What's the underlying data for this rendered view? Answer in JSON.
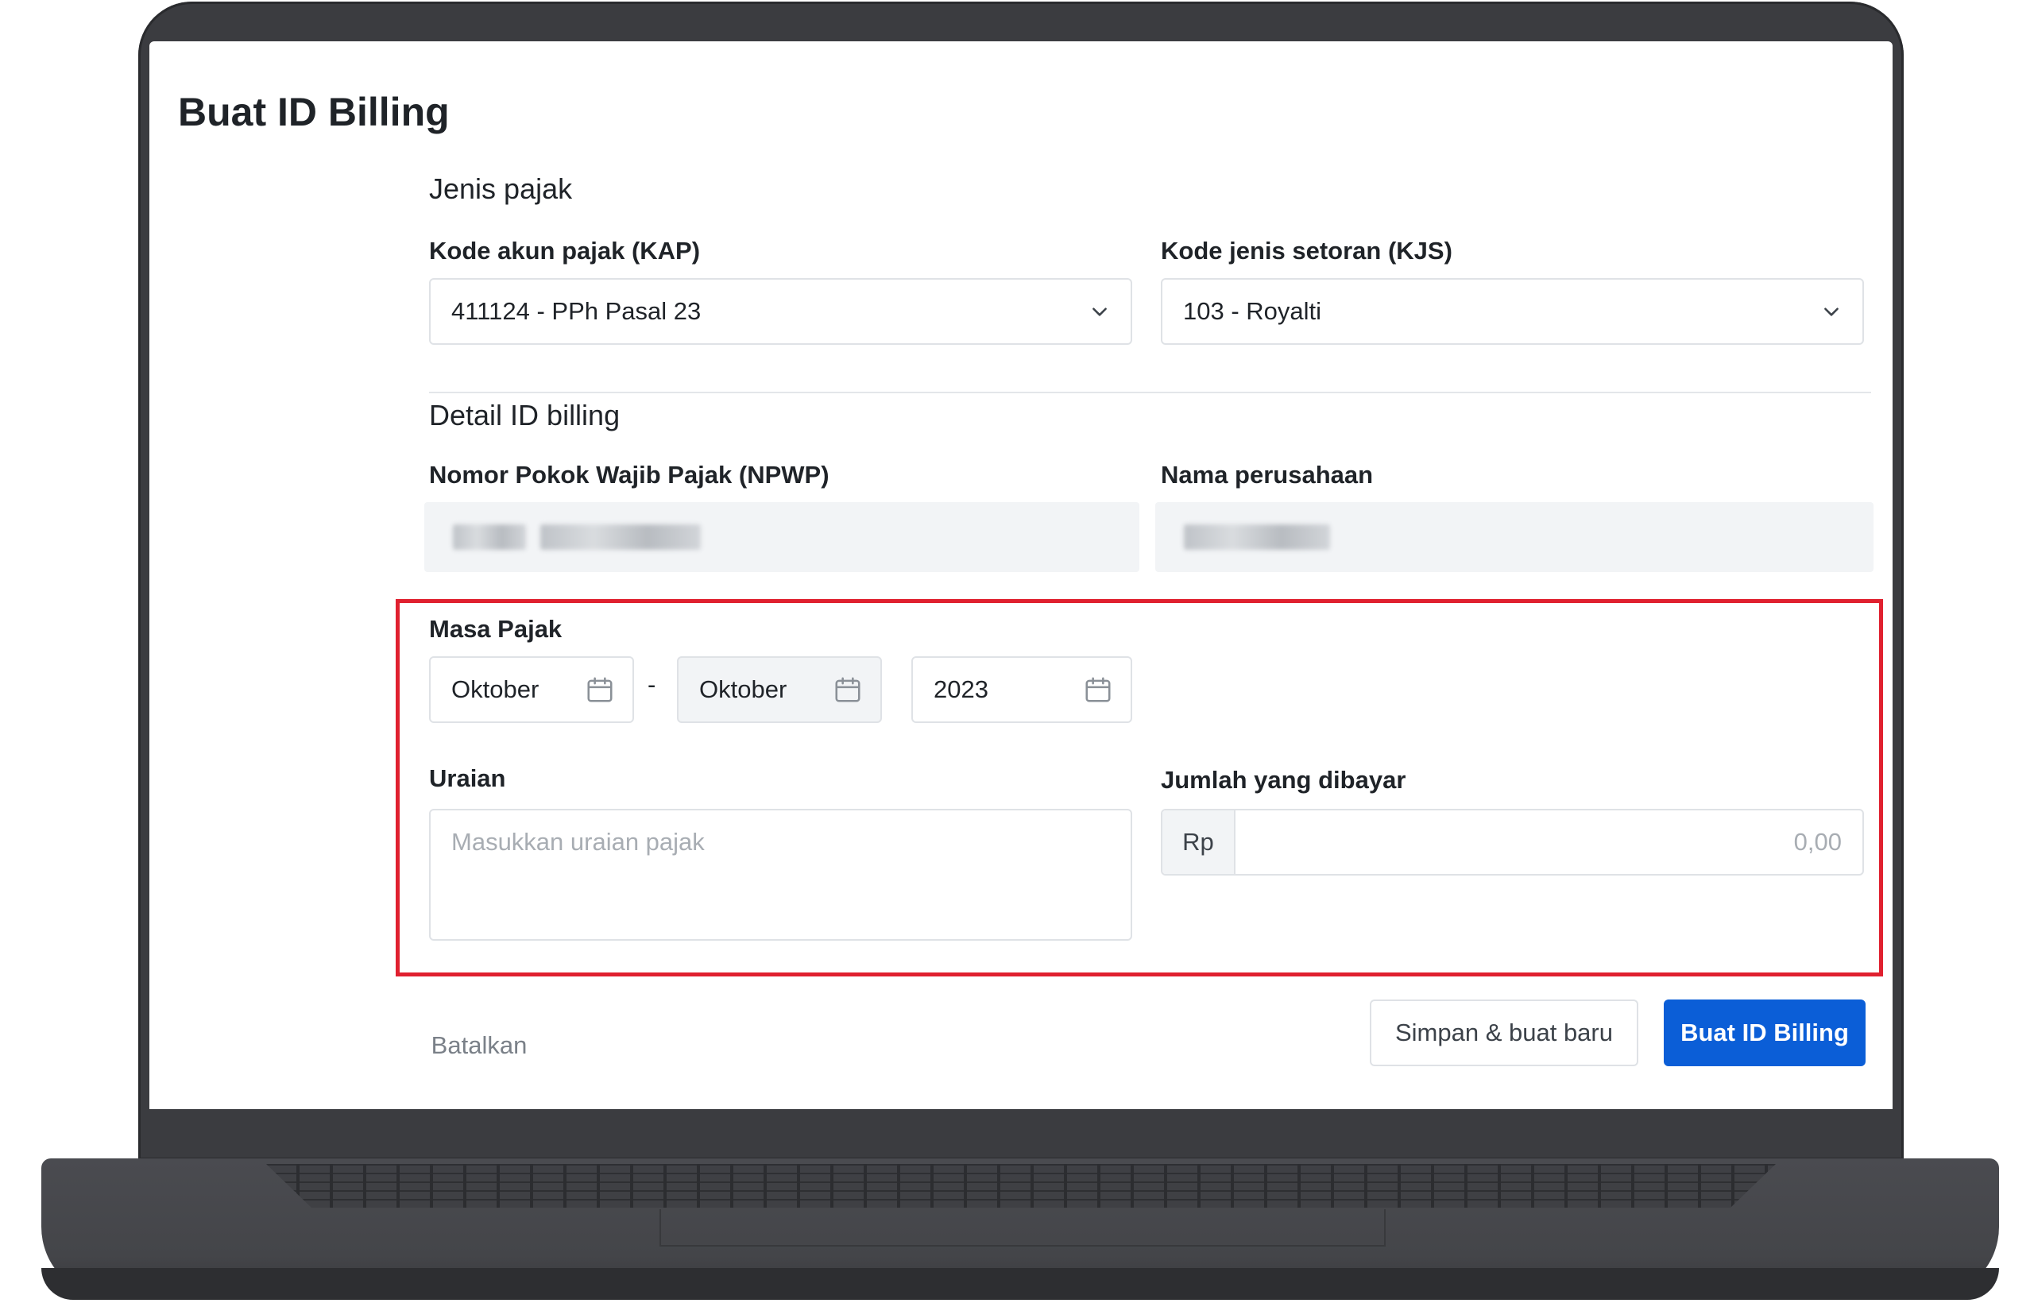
{
  "page": {
    "title": "Buat ID Billing"
  },
  "jenis_pajak": {
    "section_title": "Jenis pajak",
    "kap": {
      "label": "Kode akun pajak (KAP)",
      "value": "411124 - PPh Pasal 23"
    },
    "kjs": {
      "label": "Kode jenis setoran (KJS)",
      "value": "103 - Royalti"
    }
  },
  "detail": {
    "section_title": "Detail ID billing",
    "npwp": {
      "label": "Nomor Pokok Wajib Pajak (NPWP)"
    },
    "company": {
      "label": "Nama perusahaan"
    }
  },
  "masa_pajak": {
    "label": "Masa Pajak",
    "from": "Oktober",
    "separator": "-",
    "to": "Oktober",
    "year": "2023"
  },
  "uraian": {
    "label": "Uraian",
    "placeholder": "Masukkan uraian pajak"
  },
  "jumlah": {
    "label": "Jumlah yang dibayar",
    "prefix": "Rp",
    "placeholder": "0,00"
  },
  "actions": {
    "cancel": "Batalkan",
    "save_new": "Simpan & buat baru",
    "create": "Buat ID Billing"
  },
  "colors": {
    "primary": "#0b5ed7",
    "highlight": "#e0202f",
    "frame": "#3b3c40"
  },
  "icons": {
    "select": "chevron-down-icon",
    "date": "calendar-icon"
  }
}
